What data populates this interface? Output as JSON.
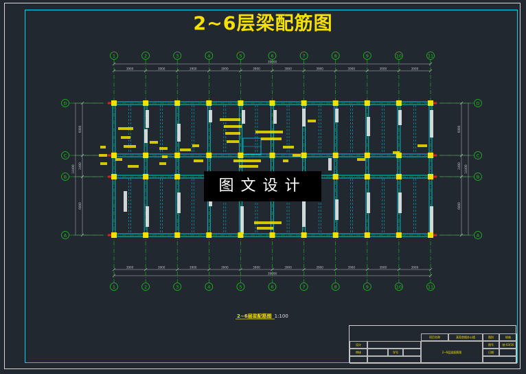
{
  "title": "2~6层梁配筋图",
  "watermark": "图文设计",
  "column_axes": [
    "1",
    "2",
    "3",
    "4",
    "5",
    "6",
    "7",
    "8",
    "9",
    "10",
    "11"
  ],
  "row_axes": [
    "D",
    "C",
    "B",
    "A"
  ],
  "bay_dimensions": [
    "3900",
    "3900",
    "3900",
    "3900",
    "3900",
    "3900",
    "3900",
    "3900",
    "3900",
    "3900"
  ],
  "overall_length": "39000",
  "left_row_dims": [
    "6000",
    "2400",
    "6000"
  ],
  "right_row_dims": [
    "6000",
    "2400",
    "6000"
  ],
  "overall_width": "14400",
  "drawing_caption": {
    "name": "2~6层梁配筋图",
    "scale": "1:100"
  },
  "title_block": {
    "project_label": "项目名称",
    "project_value": "某宿舍楼办公楼",
    "drawing_name": "2~6层梁配筋图",
    "designer_label": "设计",
    "check_label": "审核",
    "student_label": "学号",
    "drawing_no_label": "图号",
    "drawing_no_value": "结-03/16",
    "sheet_label": "图别",
    "sheet_value": "结施",
    "date_label": "日期"
  },
  "colors": {
    "axis": "#20c020",
    "beam": "#00c8e0",
    "column": "#f5e000",
    "dimension": "#c0c0c0",
    "annotation": "#f5e000",
    "rebar_text": "#f0f0f0",
    "highlight": "#e02020"
  }
}
